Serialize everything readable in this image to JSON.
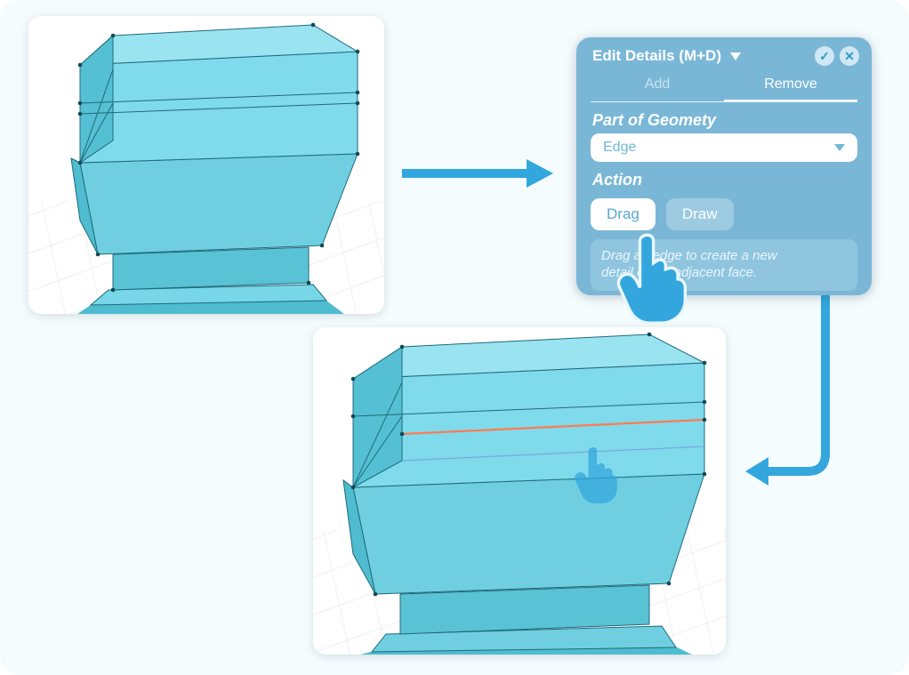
{
  "panel": {
    "title": "Edit Details (M+D)",
    "tabs": {
      "add": "Add",
      "remove": "Remove",
      "active": "remove"
    },
    "geometry_label": "Part of Geomety",
    "geometry_value": "Edge",
    "action_label": "Action",
    "buttons": {
      "drag": "Drag",
      "draw": "Draw"
    },
    "hint_line1": "Drag an edge to create a new",
    "hint_line2": "detail on an adjacent face."
  },
  "colors": {
    "accent": "#33a7dd",
    "panel": "#7ab7d6",
    "shape_fill": "#77d6e8",
    "shape_dark": "#4fbccf",
    "edge": "#1f6a7a",
    "highlight": "#ff7a4d"
  }
}
